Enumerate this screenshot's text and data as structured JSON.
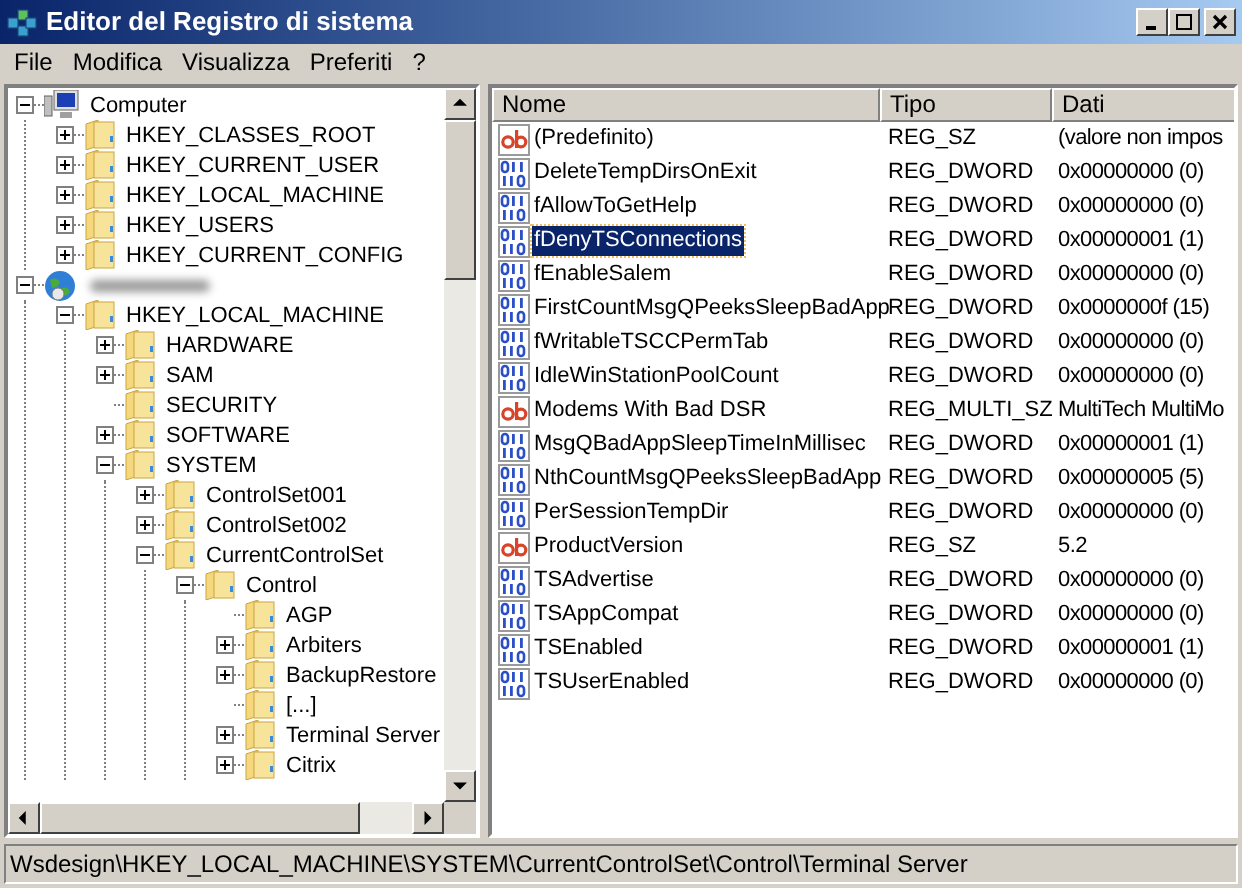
{
  "window": {
    "title": "Editor del Registro di sistema"
  },
  "menu": [
    "File",
    "Modifica",
    "Visualizza",
    "Preferiti",
    "?"
  ],
  "tree": [
    {
      "label": "Computer",
      "expanded": true,
      "children": [
        {
          "label": "HKEY_CLASSES_ROOT",
          "expanded": false
        },
        {
          "label": "HKEY_CURRENT_USER",
          "expanded": false
        },
        {
          "label": "HKEY_LOCAL_MACHINE",
          "expanded": false
        },
        {
          "label": "HKEY_USERS",
          "expanded": false
        },
        {
          "label": "HKEY_CURRENT_CONFIG",
          "expanded": false
        }
      ]
    },
    {
      "expanded": true,
      "children": [
        {
          "label": "HKEY_LOCAL_MACHINE",
          "expanded": true,
          "children": [
            {
              "label": "HARDWARE",
              "expanded": false
            },
            {
              "label": "SAM",
              "expanded": false
            },
            {
              "label": "SECURITY"
            },
            {
              "label": "SOFTWARE",
              "expanded": false
            },
            {
              "label": "SYSTEM",
              "expanded": true,
              "children": [
                {
                  "label": "ControlSet001",
                  "expanded": false
                },
                {
                  "label": "ControlSet002",
                  "expanded": false
                },
                {
                  "label": "CurrentControlSet",
                  "expanded": true,
                  "children": [
                    {
                      "label": "Control",
                      "expanded": true,
                      "children": [
                        {
                          "label": "AGP"
                        },
                        {
                          "label": "Arbiters",
                          "expanded": false
                        },
                        {
                          "label": "BackupRestore",
                          "expanded": false
                        },
                        {
                          "label": "[...]"
                        },
                        {
                          "label": "Terminal Server",
                          "expanded": false
                        },
                        {
                          "label": "Citrix",
                          "expanded": false
                        }
                      ]
                    }
                  ]
                }
              ]
            }
          ]
        }
      ]
    }
  ],
  "table": {
    "columns": [
      "Nome",
      "Tipo",
      "Dati"
    ],
    "rows": [
      {
        "kind": "string",
        "name": "(Predefinito)",
        "type": "REG_SZ",
        "data": "(valore non impos",
        "selected": false
      },
      {
        "kind": "binary",
        "name": "DeleteTempDirsOnExit",
        "type": "REG_DWORD",
        "data": "0x00000000 (0)",
        "selected": false
      },
      {
        "kind": "binary",
        "name": "fAllowToGetHelp",
        "type": "REG_DWORD",
        "data": "0x00000000 (0)",
        "selected": false
      },
      {
        "kind": "binary",
        "name": "fDenyTSConnections",
        "type": "REG_DWORD",
        "data": "0x00000001 (1)",
        "selected": true
      },
      {
        "kind": "binary",
        "name": "fEnableSalem",
        "type": "REG_DWORD",
        "data": "0x00000000 (0)",
        "selected": false
      },
      {
        "kind": "binary",
        "name": "FirstCountMsgQPeeksSleepBadApp",
        "type": "REG_DWORD",
        "data": "0x0000000f (15)",
        "selected": false
      },
      {
        "kind": "binary",
        "name": "fWritableTSCCPermTab",
        "type": "REG_DWORD",
        "data": "0x00000000 (0)",
        "selected": false
      },
      {
        "kind": "binary",
        "name": "IdleWinStationPoolCount",
        "type": "REG_DWORD",
        "data": "0x00000000 (0)",
        "selected": false
      },
      {
        "kind": "string",
        "name": "Modems With Bad DSR",
        "type": "REG_MULTI_SZ",
        "data": "MultiTech MultiMo",
        "selected": false
      },
      {
        "kind": "binary",
        "name": "MsgQBadAppSleepTimeInMillisec",
        "type": "REG_DWORD",
        "data": "0x00000001 (1)",
        "selected": false
      },
      {
        "kind": "binary",
        "name": "NthCountMsgQPeeksSleepBadApp",
        "type": "REG_DWORD",
        "data": "0x00000005 (5)",
        "selected": false
      },
      {
        "kind": "binary",
        "name": "PerSessionTempDir",
        "type": "REG_DWORD",
        "data": "0x00000000 (0)",
        "selected": false
      },
      {
        "kind": "string",
        "name": "ProductVersion",
        "type": "REG_SZ",
        "data": "5.2",
        "selected": false
      },
      {
        "kind": "binary",
        "name": "TSAdvertise",
        "type": "REG_DWORD",
        "data": "0x00000000 (0)",
        "selected": false
      },
      {
        "kind": "binary",
        "name": "TSAppCompat",
        "type": "REG_DWORD",
        "data": "0x00000000 (0)",
        "selected": false
      },
      {
        "kind": "binary",
        "name": "TSEnabled",
        "type": "REG_DWORD",
        "data": "0x00000001 (1)",
        "selected": false
      },
      {
        "kind": "binary",
        "name": "TSUserEnabled",
        "type": "REG_DWORD",
        "data": "0x00000000 (0)",
        "selected": false
      }
    ]
  },
  "status_bar": "Wsdesign\\HKEY_LOCAL_MACHINE\\SYSTEM\\CurrentControlSet\\Control\\Terminal Server"
}
